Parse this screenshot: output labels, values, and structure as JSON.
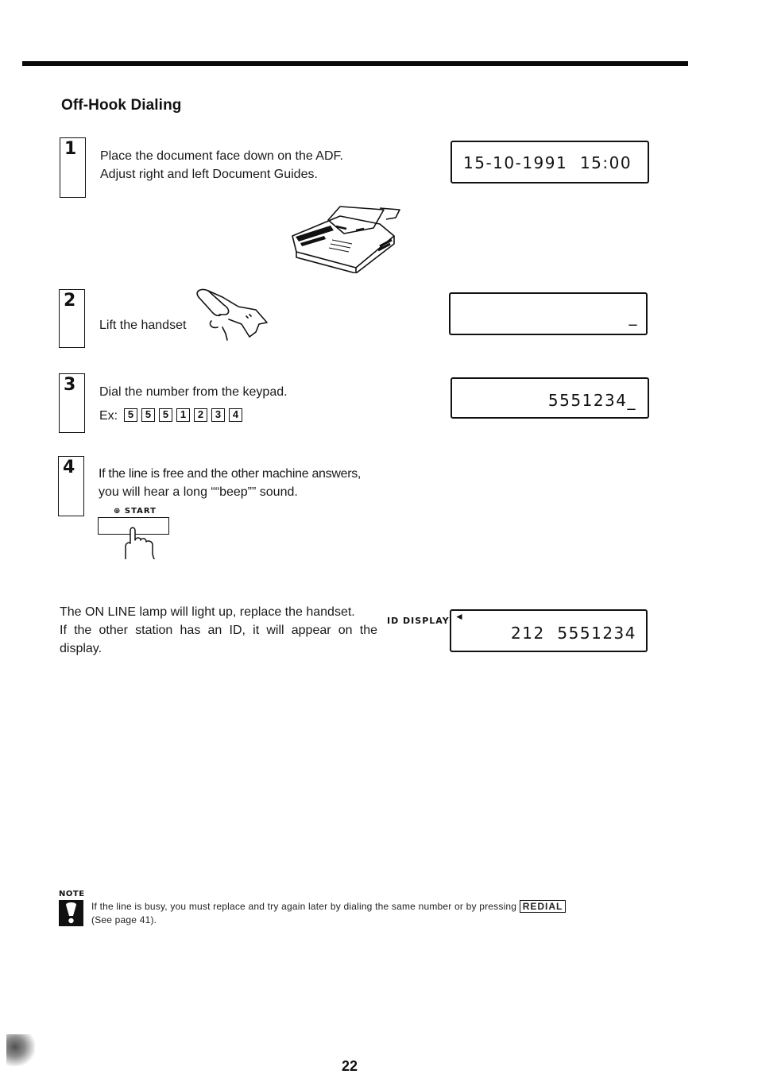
{
  "page": {
    "title": "Off-Hook Dialing",
    "page_number": "22"
  },
  "steps": [
    {
      "number": "1",
      "lines": [
        "Place the document face down on the ADF.",
        "Adjust right and left Document Guides."
      ],
      "display": "15-10-1991  15:00",
      "illustration": "fax-machine-icon"
    },
    {
      "number": "2",
      "lines": [
        "Lift the handset"
      ],
      "display": "_",
      "illustration": "handset-icon"
    },
    {
      "number": "3",
      "lines": [
        "Dial the number from the keypad."
      ],
      "example_label": "Ex:",
      "keys": [
        "5",
        "5",
        "5",
        "1",
        "2",
        "3",
        "4"
      ],
      "display": "5551234_"
    },
    {
      "number": "4",
      "lines": [
        "If the line is free and the other machine answers,",
        "you will hear a long ““beep”” sound."
      ],
      "button_label": "START",
      "button_icon": "start-icon"
    }
  ],
  "followup": {
    "lines": [
      "The ON LINE lamp will light up, replace the handset.",
      "If the other station has an ID, it will appear on the",
      "display."
    ],
    "display_label": "ID DISPLAY",
    "display_arrow": "◄",
    "display": "212  5551234"
  },
  "note": {
    "label": "NOTE",
    "text_before": "If the line is busy, you must replace and try again later by dialing the same number or by pressing ",
    "key_label": "REDIAL",
    "text_after": "(See page 41)."
  }
}
